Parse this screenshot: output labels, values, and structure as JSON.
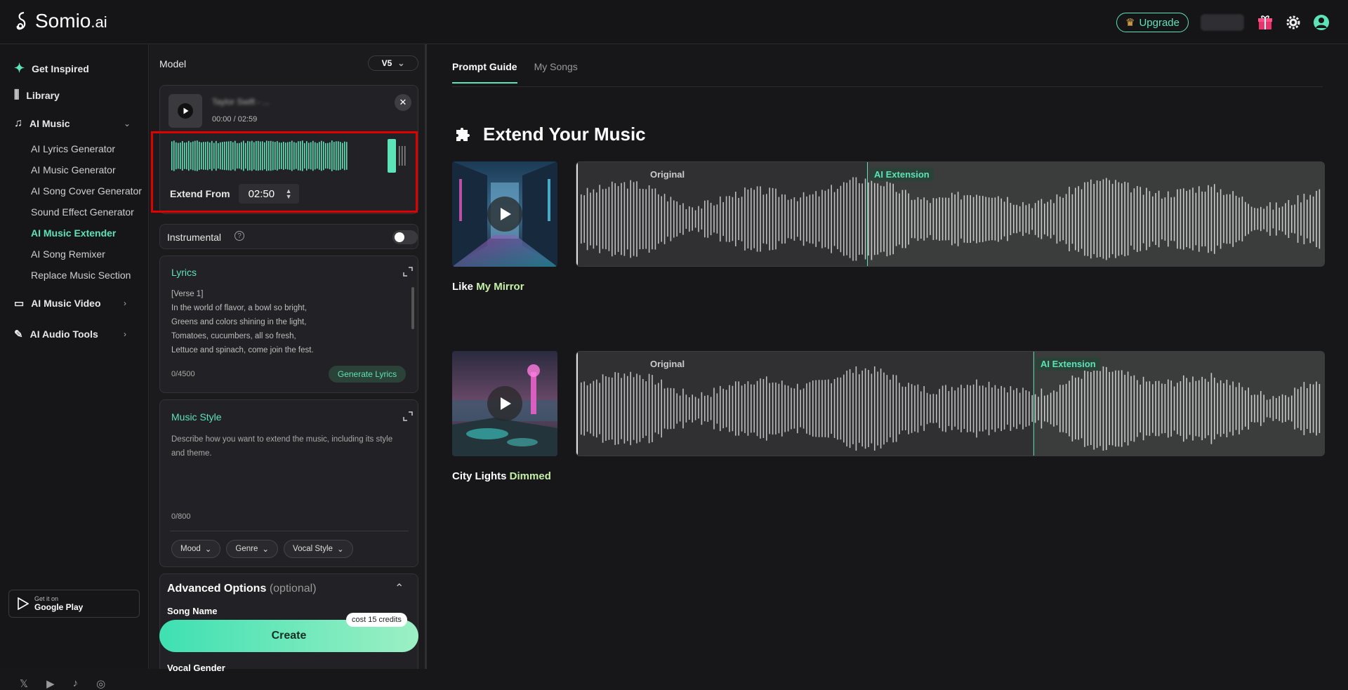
{
  "brand": {
    "name": "Somio",
    "suffix": ".ai"
  },
  "topbar": {
    "upgrade_label": "Upgrade"
  },
  "sidebar": {
    "items": [
      {
        "label": "Get Inspired"
      },
      {
        "label": "Library"
      },
      {
        "label": "AI Music"
      },
      {
        "label": "AI Music Video"
      },
      {
        "label": "AI Audio Tools"
      }
    ],
    "ai_music_sub": [
      {
        "label": "AI Lyrics Generator"
      },
      {
        "label": "AI Music Generator"
      },
      {
        "label": "AI Song Cover Generator"
      },
      {
        "label": "Sound Effect Generator"
      },
      {
        "label": "AI Music Extender"
      },
      {
        "label": "AI Song Remixer"
      },
      {
        "label": "Replace Music Section"
      }
    ],
    "google_play": {
      "small": "Get it on",
      "big": "Google Play"
    }
  },
  "panel": {
    "model_label": "Model",
    "model_value": "V5",
    "song": {
      "name": "Taylor Swift - ...",
      "time": "00:00 / 02:59"
    },
    "extend_from_label": "Extend From",
    "extend_from_value": "02:50",
    "instrumental_label": "Instrumental",
    "lyrics": {
      "title": "Lyrics",
      "text": "[Verse 1]\nIn the world of flavor, a bowl so bright,\nGreens and colors shining in the light,\nTomatoes, cucumbers, all so fresh,\nLettuce and spinach, come join the fest.",
      "counter": "0/4500",
      "generate_label": "Generate Lyrics"
    },
    "music_style": {
      "title": "Music Style",
      "placeholder": "Describe how you want to extend the music, including its style and theme.",
      "counter": "0/800",
      "chips": [
        "Mood",
        "Genre",
        "Vocal Style"
      ]
    },
    "advanced": {
      "title": "Advanced Options",
      "optional": "(optional)",
      "song_name_label": "Song Name",
      "vocal_gender_label": "Vocal Gender"
    },
    "create_label": "Create",
    "cost_label": "cost 15 credits"
  },
  "main": {
    "tabs": [
      "Prompt Guide",
      "My Songs"
    ],
    "section_title": "Extend Your Music",
    "examples": [
      {
        "title_a": "Like ",
        "title_b": "My Mirror",
        "original": "Original",
        "ai": "AI Extension"
      },
      {
        "title_a": "City Lights ",
        "title_b": "Dimmed",
        "original": "Original",
        "ai": "AI Extension"
      }
    ]
  },
  "colors": {
    "accent": "#5de3b8",
    "highlight": "#e00000",
    "background": "#17171a"
  }
}
